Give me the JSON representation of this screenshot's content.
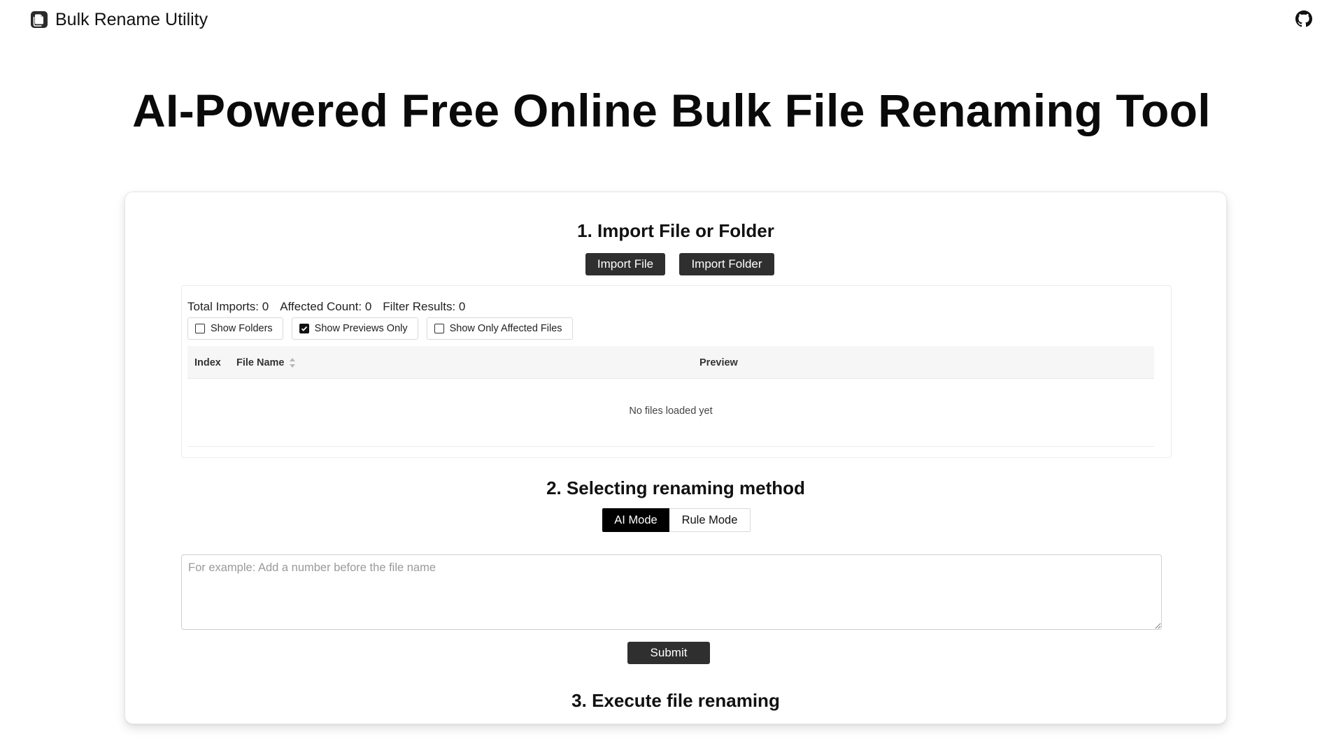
{
  "app": {
    "title": "Bulk Rename Utility",
    "icon": "document-copy-icon",
    "github_icon": "github-icon"
  },
  "hero": {
    "title": "AI-Powered Free Online Bulk File Renaming Tool"
  },
  "step1": {
    "title": "1. Import File or Folder",
    "import_file_label": "Import File",
    "import_folder_label": "Import Folder",
    "stats": {
      "total_imports": "Total Imports: 0",
      "affected_count": "Affected Count: 0",
      "filter_results": "Filter Results: 0"
    },
    "filters": [
      {
        "label": "Show Folders",
        "checked": false
      },
      {
        "label": "Show Previews Only",
        "checked": true
      },
      {
        "label": "Show Only Affected Files",
        "checked": false
      }
    ],
    "table": {
      "columns": [
        "Index",
        "File Name",
        "Preview"
      ],
      "sort_icon": "sort-icon",
      "empty_message": "No files loaded yet"
    }
  },
  "step2": {
    "title": "2. Selecting renaming method",
    "modes": [
      "AI Mode",
      "Rule Mode"
    ],
    "active_mode": "AI Mode",
    "prompt": {
      "value": "",
      "placeholder": "For example: Add a number before the file name"
    },
    "submit_label": "Submit"
  },
  "step3": {
    "title": "3. Execute file renaming"
  },
  "colors": {
    "button_dark": "#2f2f2f",
    "active_mode_bg": "#000000",
    "card_border": "#e5e7eb"
  }
}
